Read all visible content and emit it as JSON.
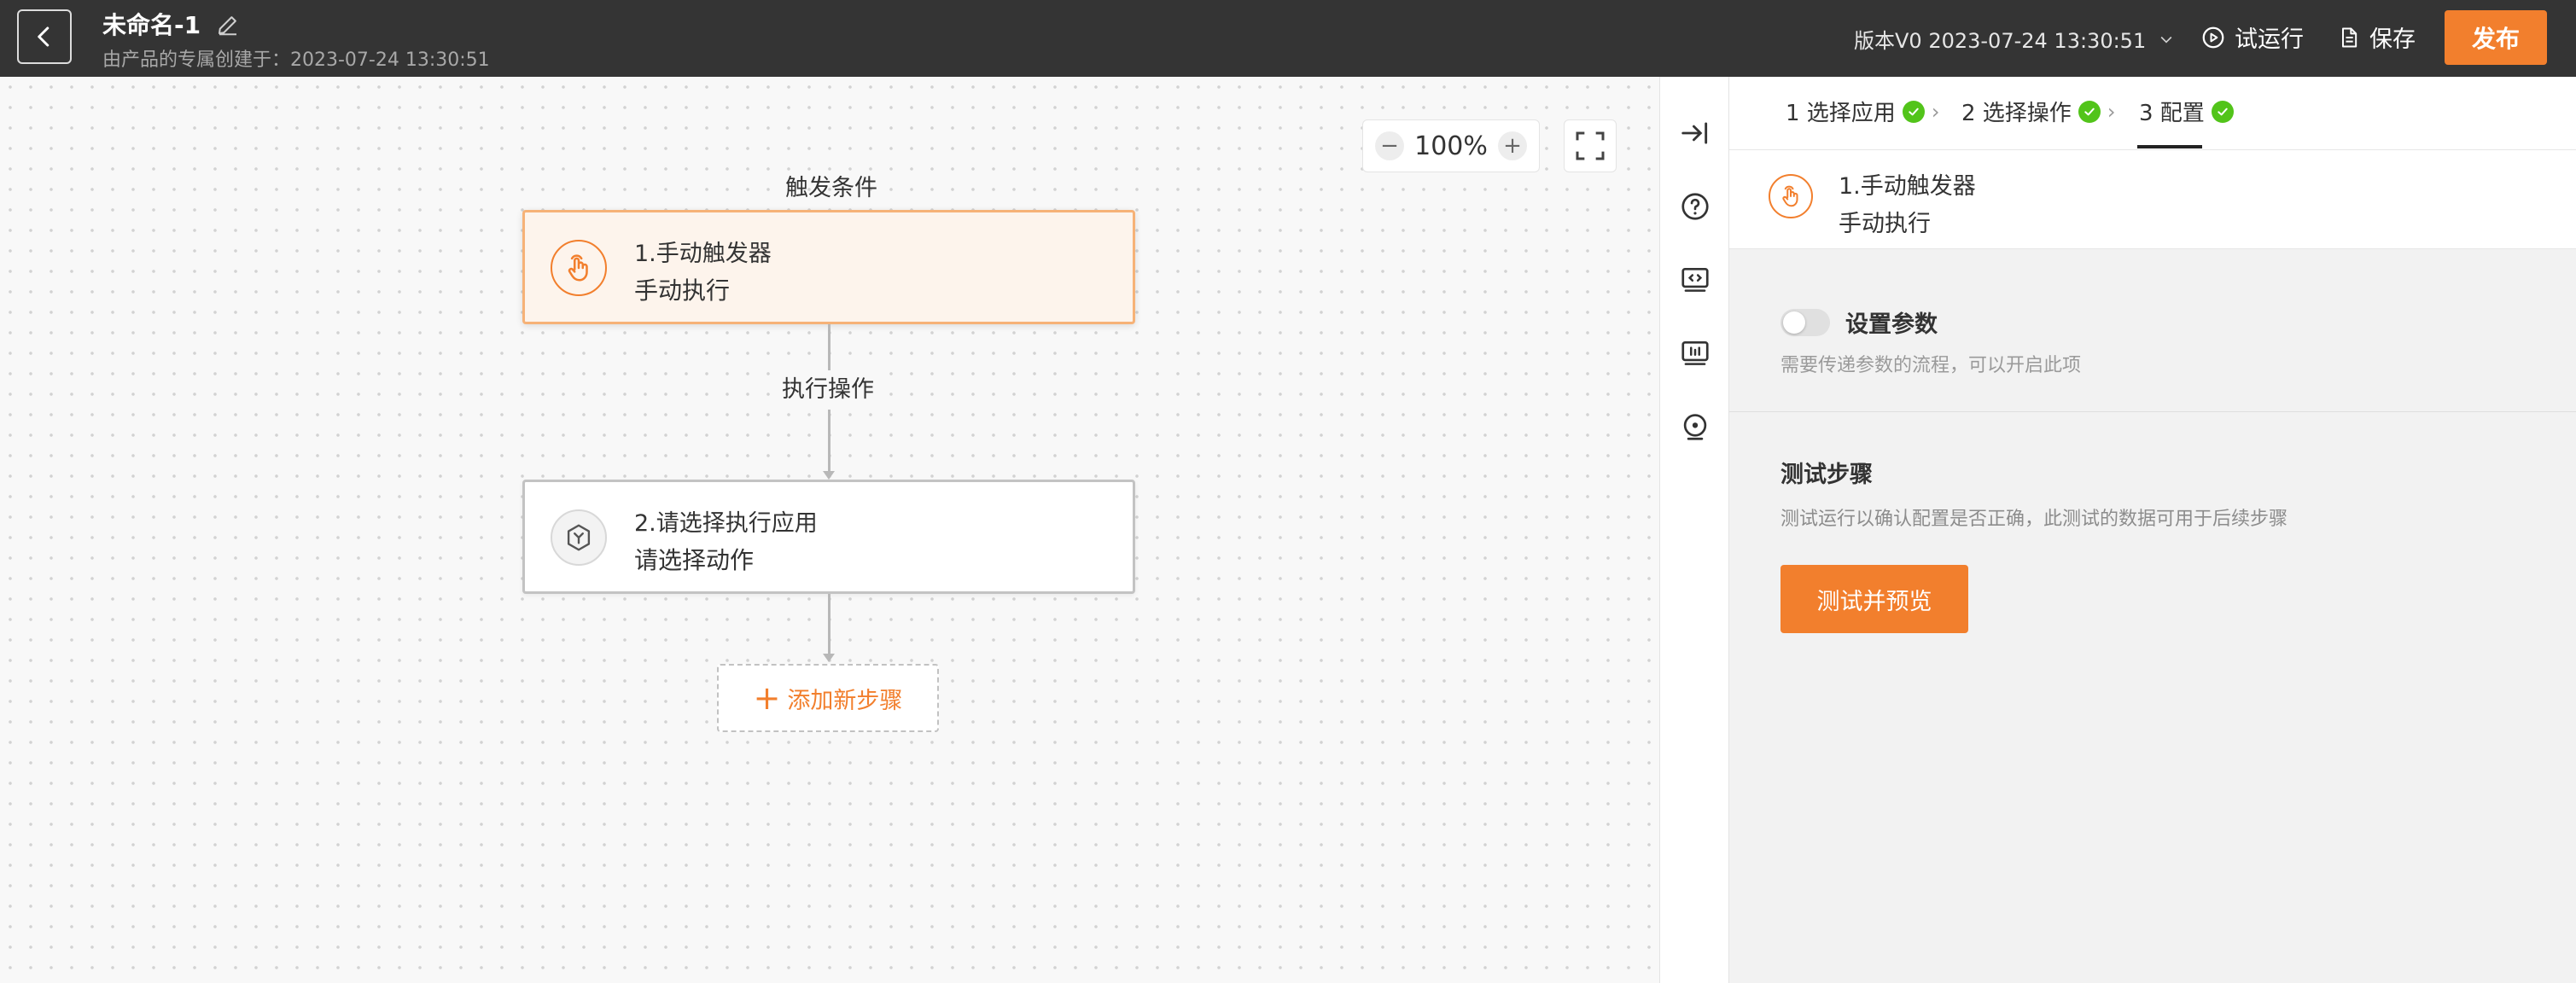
{
  "header": {
    "title": "未命名-1",
    "subtitle": "由产品的专属创建于：2023-07-24 13:30:51",
    "version": "版本V0 2023-07-24 13:30:51",
    "run_label": "试运行",
    "save_label": "保存",
    "publish_label": "发布"
  },
  "canvas": {
    "zoom": "100%",
    "zoom_out": "−",
    "zoom_in": "+",
    "trigger_label": "触发条件",
    "action_label": "执行操作",
    "nodes": [
      {
        "title": "1.手动触发器",
        "subtitle": "手动执行"
      },
      {
        "title": "2.请选择执行应用",
        "subtitle": "请选择动作"
      }
    ],
    "add_step_plus": "+",
    "add_step_label": "添加新步骤"
  },
  "rail": {
    "icons": [
      "collapse-panel-icon",
      "help-icon",
      "code-icon",
      "log-icon",
      "location-icon"
    ]
  },
  "panel": {
    "steps": [
      {
        "label": "1 选择应用",
        "done": true
      },
      {
        "label": "2 选择操作",
        "done": true
      },
      {
        "label": "3 配置",
        "done": true,
        "active": true
      }
    ],
    "trigger_title": "1.手动触发器",
    "trigger_sub": "手动执行",
    "param_label": "设置参数",
    "param_enabled": false,
    "param_hint": "需要传递参数的流程，可以开启此项",
    "test_title": "测试步骤",
    "test_hint": "测试运行以确认配置是否正确，此测试的数据可用于后续步骤",
    "test_button": "测试并预览"
  },
  "colors": {
    "accent": "#f27f2d",
    "topbar": "#343434",
    "success": "#52c41a"
  }
}
